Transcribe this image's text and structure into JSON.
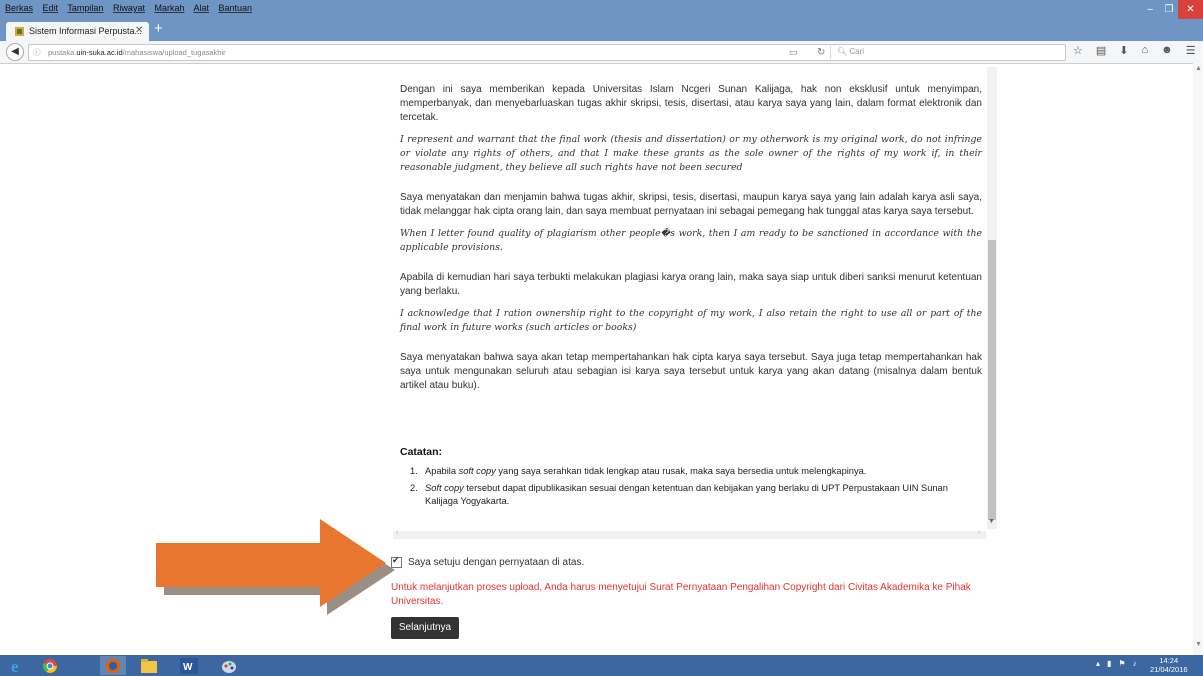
{
  "menu": [
    "Berkas",
    "Edit",
    "Tampilan",
    "Riwayat",
    "Markah",
    "Alat",
    "Bantuan"
  ],
  "tab": {
    "title": "Sistem Informasi Perpusta...",
    "close": "✕"
  },
  "url": {
    "host_prefix": "pustaka.",
    "host_bold": "uin-suka.ac.id",
    "path": "/mahasiswa/upload_tugasakhir"
  },
  "search_placeholder": "Cari",
  "content": {
    "p1": "Dengan ini saya memberikan kepada Universitas Islam Ncgeri Sunan Kalijaga, hak non eksklusif untuk menyimpan, memperbanyak, dan menyebarluaskan tugas akhir skripsi, tesis, disertasi, atau karya saya yang lain, dalam format elektronik dan tercetak.",
    "p1_en": "I represent and warrant that the final work (thesis and dissertation) or my otherwork is my original work, do not infringe or violate any rights of others, and that I make these grants as the sole owner of the rights of my work if, in their reasonable judgment, they believe all such rights have not been secured",
    "p2": "Saya menyatakan dan menjamin bahwa tugas akhir, skripsi, tesis, disertasi, maupun karya saya yang lain adalah karya asli saya, tidak melanggar hak cipta orang lain, dan saya membuat pernyataan ini sebagai pemegang hak tunggal atas karya saya tersebut.",
    "p2_en": "When I letter found quality of plagiarism other people�s work, then I am ready to be sanctioned in accordance with the applicable provisions.",
    "p3": "Apabila di kemudian hari saya terbukti melakukan plagiasi karya orang lain, maka saya siap untuk diberi sanksi menurut ketentuan yang berlaku.",
    "p3_en": "I acknowledge that I ration ownership right to the copyright of my work, I also retain the right to use all or part of the final work in future works (such articles or books)",
    "p4": "Saya menyatakan bahwa saya akan tetap mempertahankan hak cipta karya saya tersebut. Saya juga tetap mempertahankan hak saya untuk mengunakan seluruh atau sebagian isi karya saya tersebut untuk karya yang akan datang (misalnya dalam bentuk artikel atau buku).",
    "catatan": "Catatan:",
    "notes": [
      {
        "num": "1.",
        "pre": "Apabila ",
        "em": "soft copy",
        "post": " yang saya serahkan tidak lengkap atau rusak, maka saya bersedia untuk melengkapinya."
      },
      {
        "num": "2.",
        "pre": "",
        "em": "Soft copy",
        "post": " tersebut dapat dipublikasikan sesuai dengan ketentuan dan kebijakan yang berlaku di UPT Perpustakaan UIN Sunan Kalijaga Yogyakarta."
      }
    ]
  },
  "agree_label": "Saya setuju dengan pernyataan di atas.",
  "agree_checked": true,
  "warning": "Untuk melanjutkan proses upload, Anda harus menyetujui Surat Pernyataan Pengalihan Copyright dari Civitas Akademika ke Pihak Universitas.",
  "next_button": "Selanjutnya",
  "clock": {
    "time": "14:24",
    "date": "21/04/2016"
  },
  "colors": {
    "accent": "#6f95c5",
    "taskbar": "#3c67a1",
    "warning": "#e53232",
    "arrow": "#e8762f",
    "close_button": "#d9423b"
  }
}
